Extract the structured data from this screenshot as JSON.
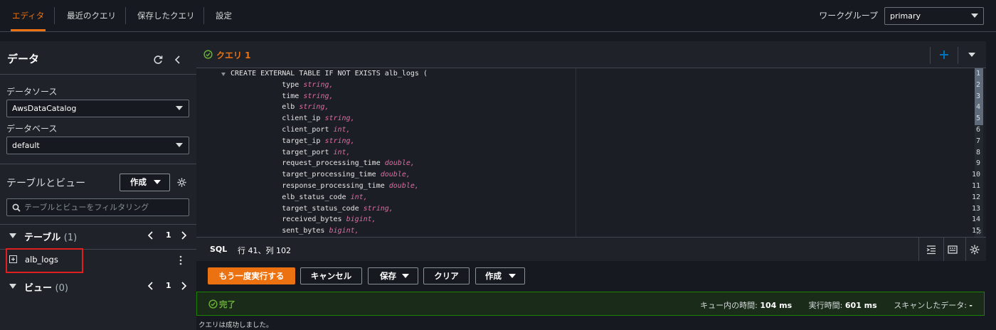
{
  "nav": {
    "tabs": [
      {
        "label": "エディタ",
        "active": true
      },
      {
        "label": "最近のクエリ"
      },
      {
        "label": "保存したクエリ"
      },
      {
        "label": "設定"
      }
    ],
    "workgroup_label": "ワークグループ",
    "workgroup_value": "primary"
  },
  "sidebar": {
    "title": "データ",
    "datasource_label": "データソース",
    "datasource_value": "AwsDataCatalog",
    "database_label": "データベース",
    "database_value": "default",
    "tables_views_label": "テーブルとビュー",
    "create_label": "作成",
    "filter_placeholder": "テーブルとビューをフィルタリング",
    "tables_section": {
      "label": "テーブル",
      "count": "(1)",
      "page": "1"
    },
    "table_items": [
      "alb_logs"
    ],
    "views_section": {
      "label": "ビュー",
      "count": "(0)",
      "page": "1"
    }
  },
  "editor": {
    "query_tab_label": "クエリ 1",
    "lines": [
      {
        "n": "1",
        "text": "CREATE EXTERNAL TABLE IF NOT EXISTS alb_logs (",
        "type": ""
      },
      {
        "n": "2",
        "text": "            type ",
        "type": "string,"
      },
      {
        "n": "3",
        "text": "            time ",
        "type": "string,"
      },
      {
        "n": "4",
        "text": "            elb ",
        "type": "string,"
      },
      {
        "n": "5",
        "text": "            client_ip ",
        "type": "string,"
      },
      {
        "n": "6",
        "text": "            client_port ",
        "type": "int,"
      },
      {
        "n": "7",
        "text": "            target_ip ",
        "type": "string,"
      },
      {
        "n": "8",
        "text": "            target_port ",
        "type": "int,"
      },
      {
        "n": "9",
        "text": "            request_processing_time ",
        "type": "double,"
      },
      {
        "n": "10",
        "text": "            target_processing_time ",
        "type": "double,"
      },
      {
        "n": "11",
        "text": "            response_processing_time ",
        "type": "double,"
      },
      {
        "n": "12",
        "text": "            elb_status_code ",
        "type": "int,"
      },
      {
        "n": "13",
        "text": "            target_status_code ",
        "type": "string,"
      },
      {
        "n": "14",
        "text": "            received_bytes ",
        "type": "bigint,"
      },
      {
        "n": "15",
        "text": "            sent_bytes ",
        "type": "bigint,"
      }
    ],
    "language": "SQL",
    "cursor_position": "行 41、列 102"
  },
  "actions": {
    "rerun_label": "もう一度実行する",
    "cancel_label": "キャンセル",
    "save_label": "保存",
    "clear_label": "クリア",
    "create_label": "作成"
  },
  "result": {
    "status": "完了",
    "queue_time_label": "キュー内の時間:",
    "queue_time_value": "104 ms",
    "run_time_label": "実行時間:",
    "run_time_value": "601 ms",
    "scanned_label": "スキャンしたデータ:",
    "scanned_value": "-",
    "message": "クエリは成功しました。"
  },
  "colors": {
    "accent": "#ec7211",
    "success": "#1d8102",
    "keyword": "#e06c9f",
    "add_icon": "#0073bb"
  }
}
